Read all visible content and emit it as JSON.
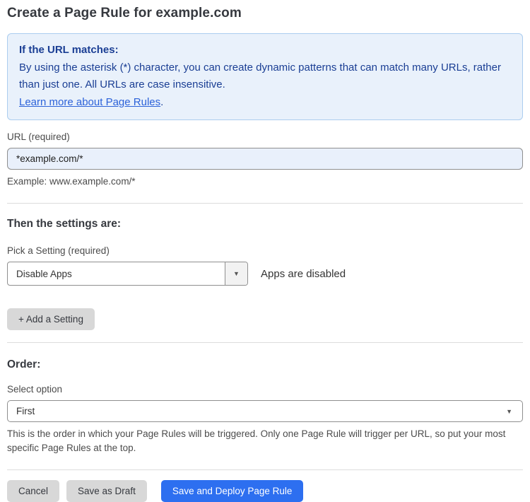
{
  "page": {
    "title": "Create a Page Rule for example.com"
  },
  "info_box": {
    "heading": "If the URL matches:",
    "body": "By using the asterisk (*) character, you can create dynamic patterns that can match many URLs, rather than just one. All URLs are case insensitive.",
    "link_label": "Learn more about Page Rules",
    "link_suffix": "."
  },
  "url_field": {
    "label": "URL (required)",
    "value": "*example.com/*",
    "help": "Example: www.example.com/*"
  },
  "settings_section": {
    "heading": "Then the settings are:",
    "picker_label": "Pick a Setting (required)",
    "selected_setting": "Disable Apps",
    "setting_status": "Apps are disabled",
    "add_setting_label": "+ Add a Setting"
  },
  "order_section": {
    "heading": "Order:",
    "select_label": "Select option",
    "selected_option": "First",
    "help": "This is the order in which your Page Rules will be triggered. Only one Page Rule will trigger per URL, so put your most specific Page Rules at the top."
  },
  "footer": {
    "cancel_label": "Cancel",
    "save_draft_label": "Save as Draft",
    "save_deploy_label": "Save and Deploy Page Rule"
  },
  "icons": {
    "dropdown_caret": "▼"
  },
  "colors": {
    "info_bg": "#e9f1fb",
    "info_border": "#abcdef",
    "info_text": "#1a3e94",
    "link_blue": "#2c62d9",
    "input_bg": "#e9f0fb",
    "primary_button_blue": "#2d6ff0",
    "gray_button": "#d8d8d8"
  }
}
